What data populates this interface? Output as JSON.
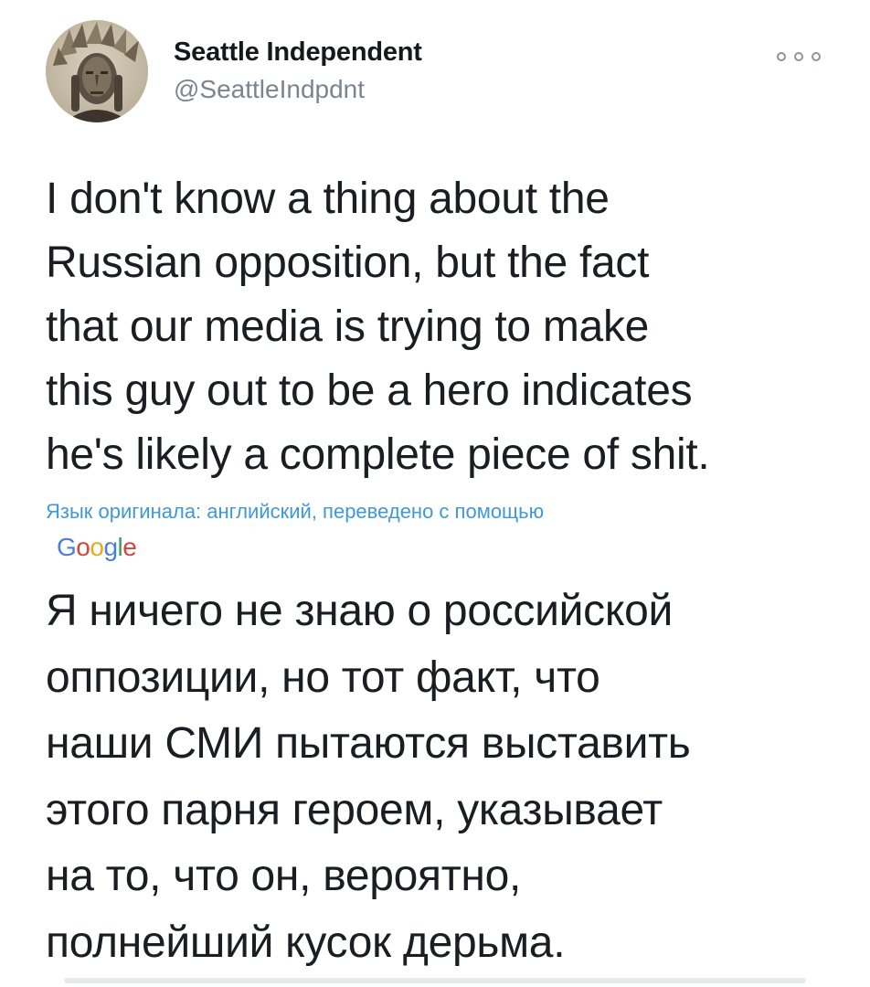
{
  "tweet": {
    "author": {
      "display_name": "Seattle Independent",
      "handle": "@SeattleIndpdnt",
      "avatar_icon": "portrait-avatar"
    },
    "more_icon": "more-options-icon",
    "text_lines": [
      "I don't know a thing about the",
      "Russian opposition, but the fact",
      "that our media is trying to make",
      "this guy out to be a hero indicates",
      "he's likely a complete piece of shit."
    ],
    "translation": {
      "note": "Язык оригинала: английский, переведено с помощью",
      "provider_letters": [
        "G",
        "o",
        "o",
        "g",
        "l",
        "e"
      ],
      "text_lines": [
        "Я ничего не знаю о российской",
        "оппозиции, но тот факт, что",
        "наши СМИ пытаются выставить",
        "этого парня героем, указывает",
        "на то, что он, вероятно,",
        "полнейший кусок дерьма."
      ]
    }
  },
  "colors": {
    "link": "#3f99d8",
    "secondary_text": "#7b858f",
    "google_blue": "#4a7fd6",
    "google_red": "#d2453d",
    "google_yellow": "#e5ab1e",
    "google_green": "#3b9e5d"
  }
}
